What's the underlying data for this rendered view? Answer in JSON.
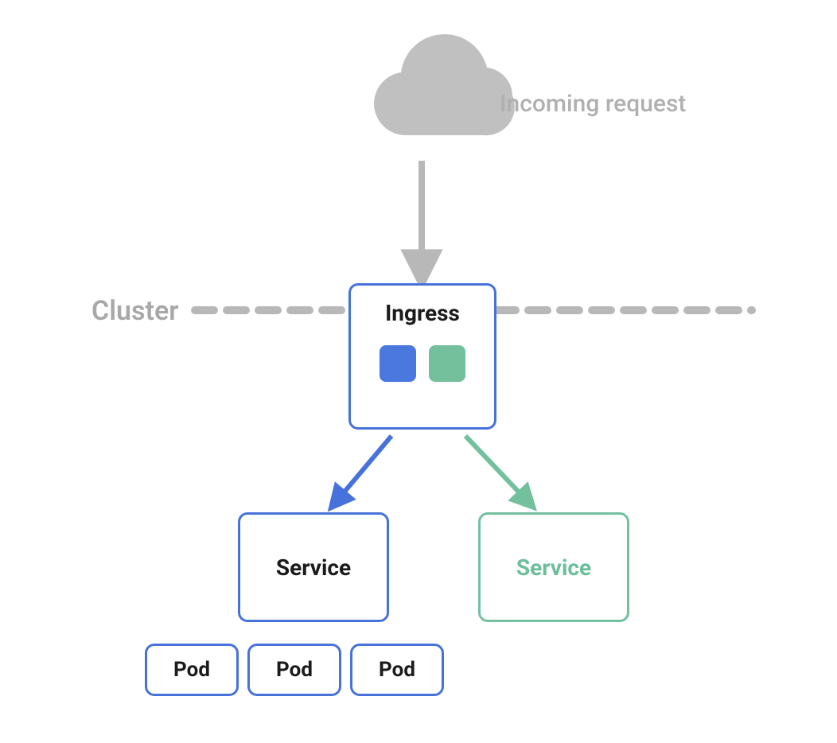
{
  "labels": {
    "incoming": "Incoming request",
    "cluster": "Cluster"
  },
  "ingress": {
    "title": "Ingress"
  },
  "services": {
    "blue": "Service",
    "green": "Service"
  },
  "pods": [
    "Pod",
    "Pod",
    "Pod"
  ],
  "colors": {
    "gray": "#b8b8b8",
    "blue": "#4672d9",
    "green": "#72c09e",
    "chip_blue": "#4a78df",
    "chip_green": "#74bf9c"
  }
}
